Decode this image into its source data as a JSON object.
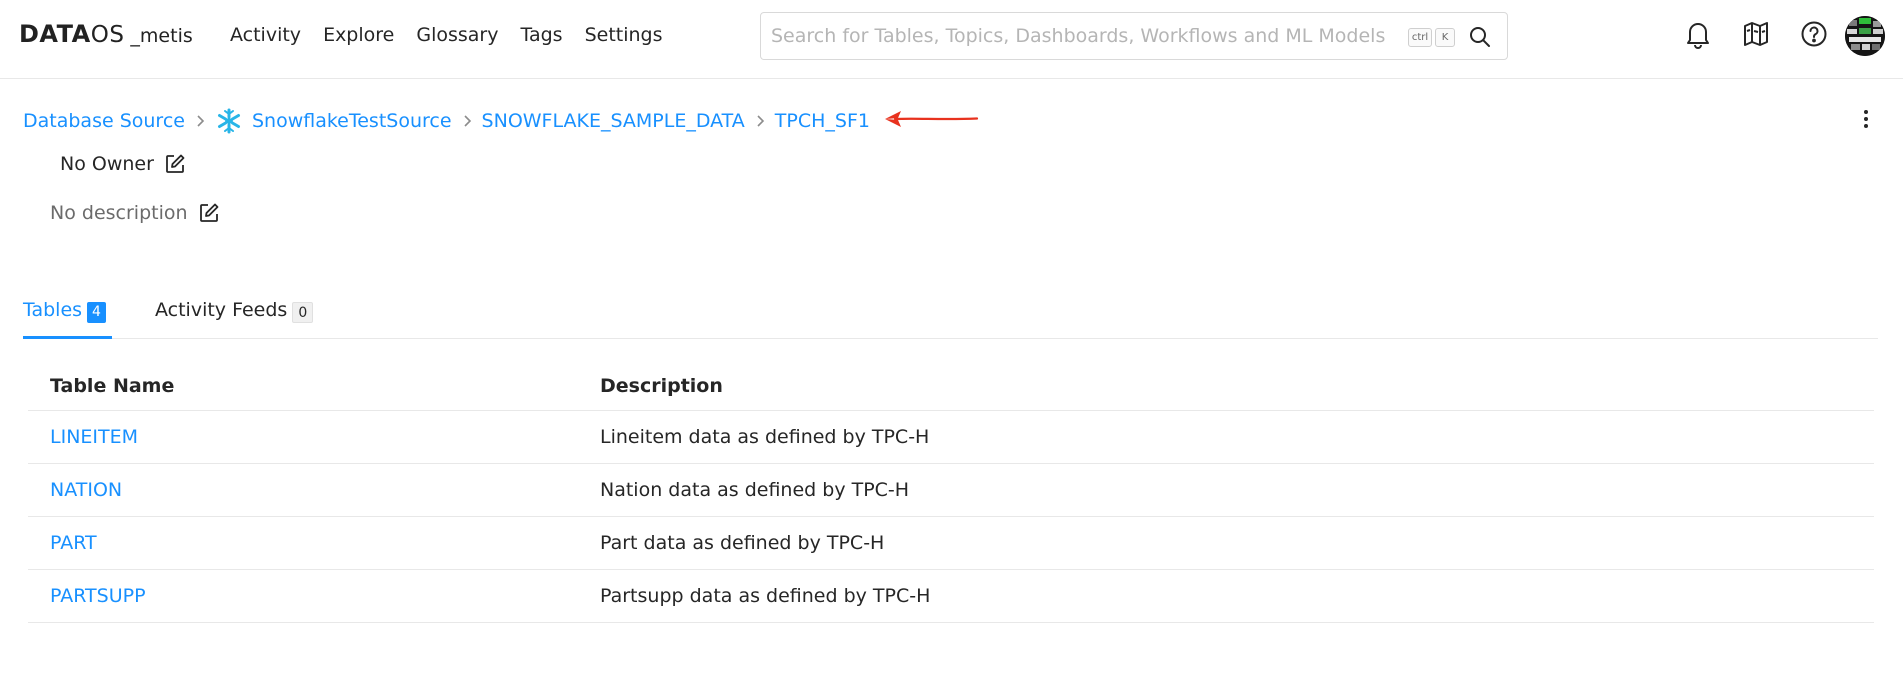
{
  "app": {
    "logo_main": "DATA",
    "logo_os": "OS",
    "logo_sub": "_metis"
  },
  "nav": {
    "items": [
      "Activity",
      "Explore",
      "Glossary",
      "Tags",
      "Settings"
    ]
  },
  "search": {
    "placeholder": "Search for Tables, Topics, Dashboards, Workflows and ML Models",
    "value": "",
    "kbd_ctrl": "ctrl",
    "kbd_key": "K"
  },
  "icons": {
    "notifications": "bell-icon",
    "tour": "map-icon",
    "help": "help-circle-icon",
    "search": "search-icon",
    "edit": "edit-icon",
    "source": "snowflake-icon",
    "more": "kebab-menu-icon"
  },
  "breadcrumb": {
    "items": [
      "Database Source",
      "SnowflakeTestSource",
      "SNOWFLAKE_SAMPLE_DATA",
      "TPCH_SF1"
    ]
  },
  "owner": {
    "label": "No Owner"
  },
  "description": {
    "label": "No description"
  },
  "tabs": [
    {
      "label": "Tables",
      "count": "4",
      "active": true
    },
    {
      "label": "Activity Feeds",
      "count": "0",
      "active": false
    }
  ],
  "table": {
    "headers": {
      "name": "Table Name",
      "description": "Description"
    },
    "rows": [
      {
        "name": "LINEITEM",
        "description": "Lineitem data as defined by TPC-H"
      },
      {
        "name": "NATION",
        "description": "Nation data as defined by TPC-H"
      },
      {
        "name": "PART",
        "description": "Part data as defined by TPC-H"
      },
      {
        "name": "PARTSUPP",
        "description": "Partsupp data as defined by TPC-H"
      }
    ]
  },
  "colors": {
    "accent": "#1890ff",
    "text": "#262626",
    "muted": "#6b6b6b",
    "annotation": "#e8321e",
    "snowflake": "#29b5e8",
    "border": "#e8e8e8"
  }
}
